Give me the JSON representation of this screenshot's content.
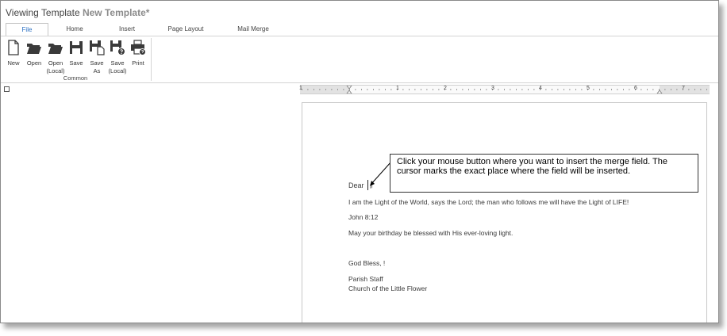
{
  "window": {
    "title_prefix": "Viewing Template",
    "title_name": "New Template*"
  },
  "tabs": [
    {
      "label": "File",
      "active": true
    },
    {
      "label": "Home",
      "active": false
    },
    {
      "label": "Insert",
      "active": false
    },
    {
      "label": "Page Layout",
      "active": false
    },
    {
      "label": "Mail Merge",
      "active": false
    }
  ],
  "ribbon": {
    "group_label": "Common",
    "buttons": [
      {
        "label": "New",
        "icon": "new-document-icon"
      },
      {
        "label": "Open",
        "icon": "folder-open-icon"
      },
      {
        "label": "Open\n(Local)",
        "icon": "folder-open-local-icon"
      },
      {
        "label": "Save",
        "icon": "floppy-disk-icon"
      },
      {
        "label": "Save\nAs",
        "icon": "save-as-icon"
      },
      {
        "label": "Save\n(Local)",
        "icon": "save-local-icon"
      },
      {
        "label": "Print",
        "icon": "printer-icon"
      }
    ]
  },
  "ruler": {
    "numbers": [
      "1",
      "1",
      "2",
      "3",
      "4",
      "5",
      "6",
      "7"
    ]
  },
  "letter": {
    "greeting": "Dear",
    "cursor_mark": "#",
    "line1": "I am the Light of the World, says the Lord; the man who follows me will have the Light of LIFE!",
    "line2": "John 8:12",
    "line3": "May your birthday be blessed with His ever-loving light.",
    "closing": "God Bless,  !",
    "signature1": "Parish Staff",
    "signature2": "Church of the Little Flower"
  },
  "callout": {
    "text": "Click your mouse button where you want to insert the merge field. The cursor marks the exact place where the field will be inserted."
  },
  "colors": {
    "active_tab_text": "#2a6fc2",
    "title_name": "#8b8b8b",
    "icon_dark": "#3a3a3a"
  }
}
